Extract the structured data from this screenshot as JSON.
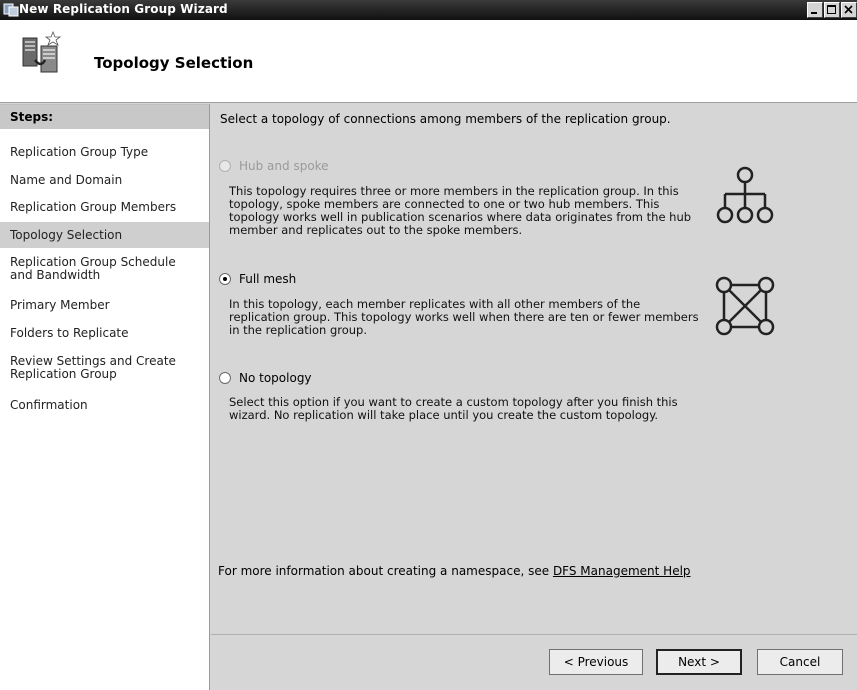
{
  "window": {
    "title": "New Replication Group Wizard"
  },
  "header": {
    "title": "Topology Selection"
  },
  "steps": {
    "heading": "Steps:",
    "items": [
      {
        "label": "Replication Group Type"
      },
      {
        "label": "Name and Domain"
      },
      {
        "label": "Replication Group Members"
      },
      {
        "label": "Topology Selection",
        "active": true
      },
      {
        "label": "Replication Group Schedule and Bandwidth"
      },
      {
        "label": "Primary Member"
      },
      {
        "label": "Folders to Replicate"
      },
      {
        "label": "Review Settings and Create Replication Group"
      },
      {
        "label": "Confirmation"
      }
    ]
  },
  "main": {
    "intro": "Select a topology of connections among members of the replication group.",
    "options": [
      {
        "label": "Hub and spoke",
        "enabled": false,
        "selected": false,
        "description": "This topology requires three or more members in the replication group. In this topology, spoke members are connected to one or two hub members. This topology works well in publication scenarios where data originates from the hub member and replicates out to the spoke members.",
        "icon": "hub-spoke-topology-icon"
      },
      {
        "label": "Full mesh",
        "enabled": true,
        "selected": true,
        "description": "In this topology, each member replicates with all other members of the replication group. This topology works well when there are ten or fewer members in the replication group.",
        "icon": "full-mesh-topology-icon"
      },
      {
        "label": "No topology",
        "enabled": true,
        "selected": false,
        "description": "Select this option if you want to create a custom topology after you finish this wizard. No replication will take place until you create the custom topology."
      }
    ],
    "help_prefix": "For more information about creating a namespace, see",
    "help_link": "DFS Management Help"
  },
  "buttons": {
    "previous": "< Previous",
    "next": "Next >",
    "cancel": "Cancel"
  }
}
